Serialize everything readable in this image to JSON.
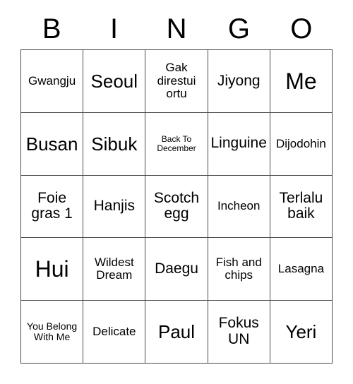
{
  "card": {
    "headers": [
      "B",
      "I",
      "N",
      "G",
      "O"
    ],
    "rows": [
      [
        {
          "text": "Gwangju",
          "size": "sm"
        },
        {
          "text": "Seoul",
          "size": "lg"
        },
        {
          "text": "Gak direstui ortu",
          "size": "sm"
        },
        {
          "text": "Jiyong",
          "size": "md"
        },
        {
          "text": "Me",
          "size": "xl"
        }
      ],
      [
        {
          "text": "Busan",
          "size": "lg"
        },
        {
          "text": "Sibuk",
          "size": "lg"
        },
        {
          "text": "Back To December",
          "size": "xxs"
        },
        {
          "text": "Linguine",
          "size": "md"
        },
        {
          "text": "Dijodohin",
          "size": "sm"
        }
      ],
      [
        {
          "text": "Foie gras 1",
          "size": "md"
        },
        {
          "text": "Hanjis",
          "size": "md"
        },
        {
          "text": "Scotch egg",
          "size": "md"
        },
        {
          "text": "Incheon",
          "size": "sm"
        },
        {
          "text": "Terlalu baik",
          "size": "md"
        }
      ],
      [
        {
          "text": "Hui",
          "size": "xl"
        },
        {
          "text": "Wildest Dream",
          "size": "sm"
        },
        {
          "text": "Daegu",
          "size": "md"
        },
        {
          "text": "Fish and chips",
          "size": "sm"
        },
        {
          "text": "Lasagna",
          "size": "sm"
        }
      ],
      [
        {
          "text": "You Belong With Me",
          "size": "xs"
        },
        {
          "text": "Delicate",
          "size": "sm"
        },
        {
          "text": "Paul",
          "size": "lg"
        },
        {
          "text": "Fokus UN",
          "size": "md"
        },
        {
          "text": "Yeri",
          "size": "lg"
        }
      ]
    ]
  },
  "colors": {
    "background": "#ffffff",
    "text": "#000000",
    "border": "#4a4a4a"
  }
}
